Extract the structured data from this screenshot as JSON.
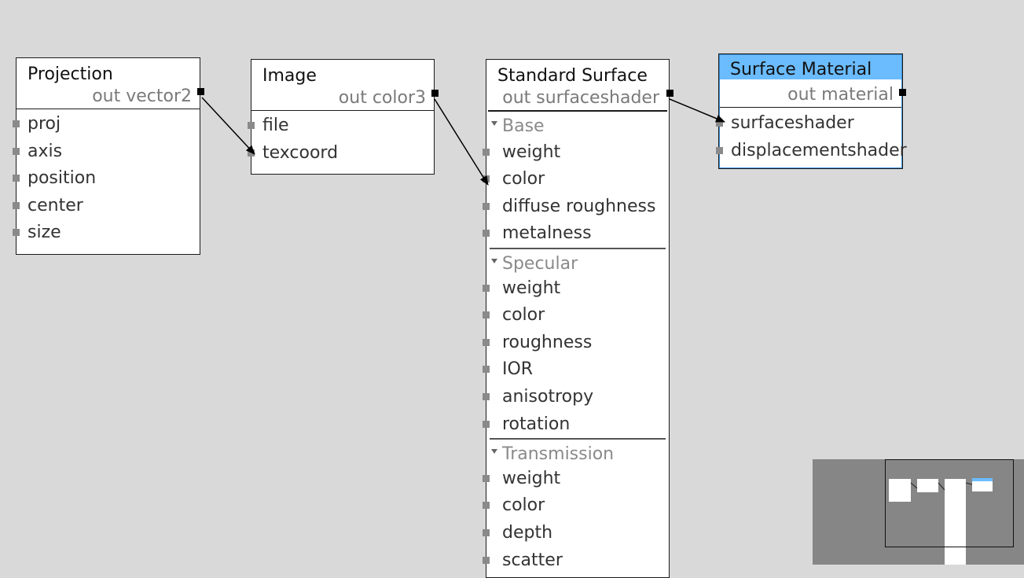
{
  "nodes": {
    "projection": {
      "title": "Projection",
      "output": "out vector2",
      "inputs": [
        "proj",
        "axis",
        "position",
        "center",
        "size"
      ]
    },
    "image": {
      "title": "Image",
      "output": "out color3",
      "inputs": [
        "file",
        "texcoord"
      ]
    },
    "standard_surface": {
      "title": "Standard Surface",
      "output": "out surfaceshader",
      "groups": [
        {
          "label": "Base",
          "inputs": [
            "weight",
            "color",
            "diffuse roughness",
            "metalness"
          ]
        },
        {
          "label": "Specular",
          "inputs": [
            "weight",
            "color",
            "roughness",
            "IOR",
            "anisotropy",
            "rotation"
          ]
        },
        {
          "label": "Transmission",
          "inputs": [
            "weight",
            "color",
            "depth",
            "scatter"
          ]
        }
      ]
    },
    "surface_material": {
      "title": "Surface Material",
      "output": "out material",
      "inputs": [
        "surfaceshader",
        "displacementshader"
      ]
    }
  },
  "colors": {
    "background": "#d9d9d9",
    "selected_header": "#6bbcff",
    "minimap_bg": "#868686"
  }
}
